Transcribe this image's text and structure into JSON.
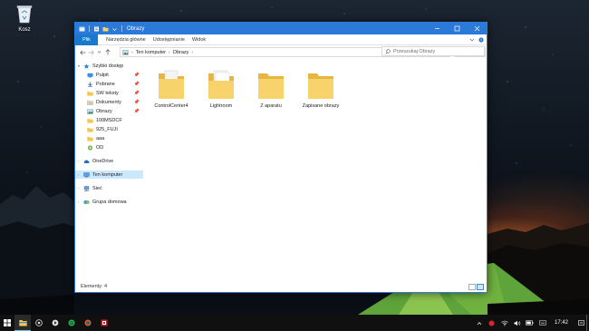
{
  "desktop": {
    "recycle_bin_label": "Kosz"
  },
  "window": {
    "title": "Obrazy",
    "ribbon": {
      "file_tab": "Plik",
      "tabs": [
        "Narzędzia główne",
        "Udostępnianie",
        "Widok"
      ]
    },
    "address": {
      "crumbs": [
        "Ten komputer",
        "Obrazy"
      ],
      "search_placeholder": "Przeszukaj Obrazy"
    },
    "nav": {
      "quick_access": "Szybki dostęp",
      "pinned": [
        {
          "label": "Pulpit",
          "icon": "desktop-icon"
        },
        {
          "label": "Pobrane",
          "icon": "download-icon"
        },
        {
          "label": "SW teksty",
          "icon": "folder-icon"
        },
        {
          "label": "Dokumenty",
          "icon": "documents-icon"
        },
        {
          "label": "Obrazy",
          "icon": "pictures-icon"
        }
      ],
      "recent": [
        {
          "label": "100MSDCF",
          "icon": "folder-icon"
        },
        {
          "label": "925_FUJI",
          "icon": "folder-icon"
        },
        {
          "label": "aaa",
          "icon": "folder-icon"
        },
        {
          "label": "OD",
          "icon": "folder-icon"
        }
      ],
      "onedrive": "OneDrive",
      "this_pc": "Ten komputer",
      "network": "Sieć",
      "homegroup": "Grupa domowa"
    },
    "folders": [
      {
        "name": "ControlCenter4"
      },
      {
        "name": "Lightroom"
      },
      {
        "name": "Z aparatu"
      },
      {
        "name": "Zapisane obrazy"
      }
    ],
    "status": "Elementy: 4"
  },
  "taskbar": {
    "time": "17:42"
  }
}
